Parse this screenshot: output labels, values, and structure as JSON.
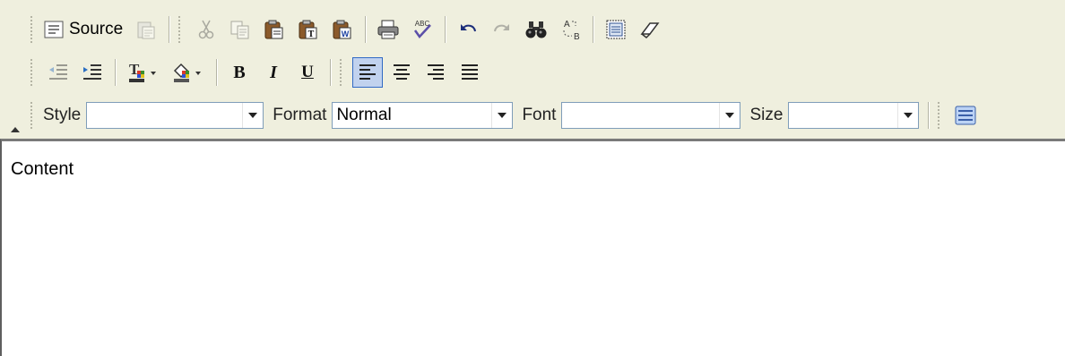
{
  "toolbar": {
    "row1": {
      "source_label": "Source"
    },
    "row2": {
      "bold_glyph": "B",
      "italic_glyph": "I",
      "underline_glyph": "U"
    },
    "row3": {
      "style_label": "Style",
      "style_value": "",
      "format_label": "Format",
      "format_value": "Normal",
      "font_label": "Font",
      "font_value": "",
      "size_label": "Size",
      "size_value": ""
    }
  },
  "content": {
    "text": "Content"
  },
  "colors": {
    "toolbar_bg": "#efefde",
    "active_button_bg": "#c1d2ee",
    "active_button_border": "#316ac5",
    "combo_border": "#7f9db9"
  },
  "icons": [
    "source-icon",
    "paste-disabled-icon",
    "cut-icon",
    "copy-icon",
    "paste-icon",
    "paste-text-icon",
    "paste-word-icon",
    "print-icon",
    "spellcheck-icon",
    "undo-icon",
    "redo-icon",
    "find-icon",
    "replace-icon",
    "select-all-icon",
    "remove-format-icon",
    "outdent-icon",
    "indent-icon",
    "text-color-icon",
    "background-color-icon",
    "bold-icon",
    "italic-icon",
    "underline-icon",
    "align-left-icon",
    "align-center-icon",
    "align-right-icon",
    "justify-icon",
    "show-blocks-icon"
  ]
}
